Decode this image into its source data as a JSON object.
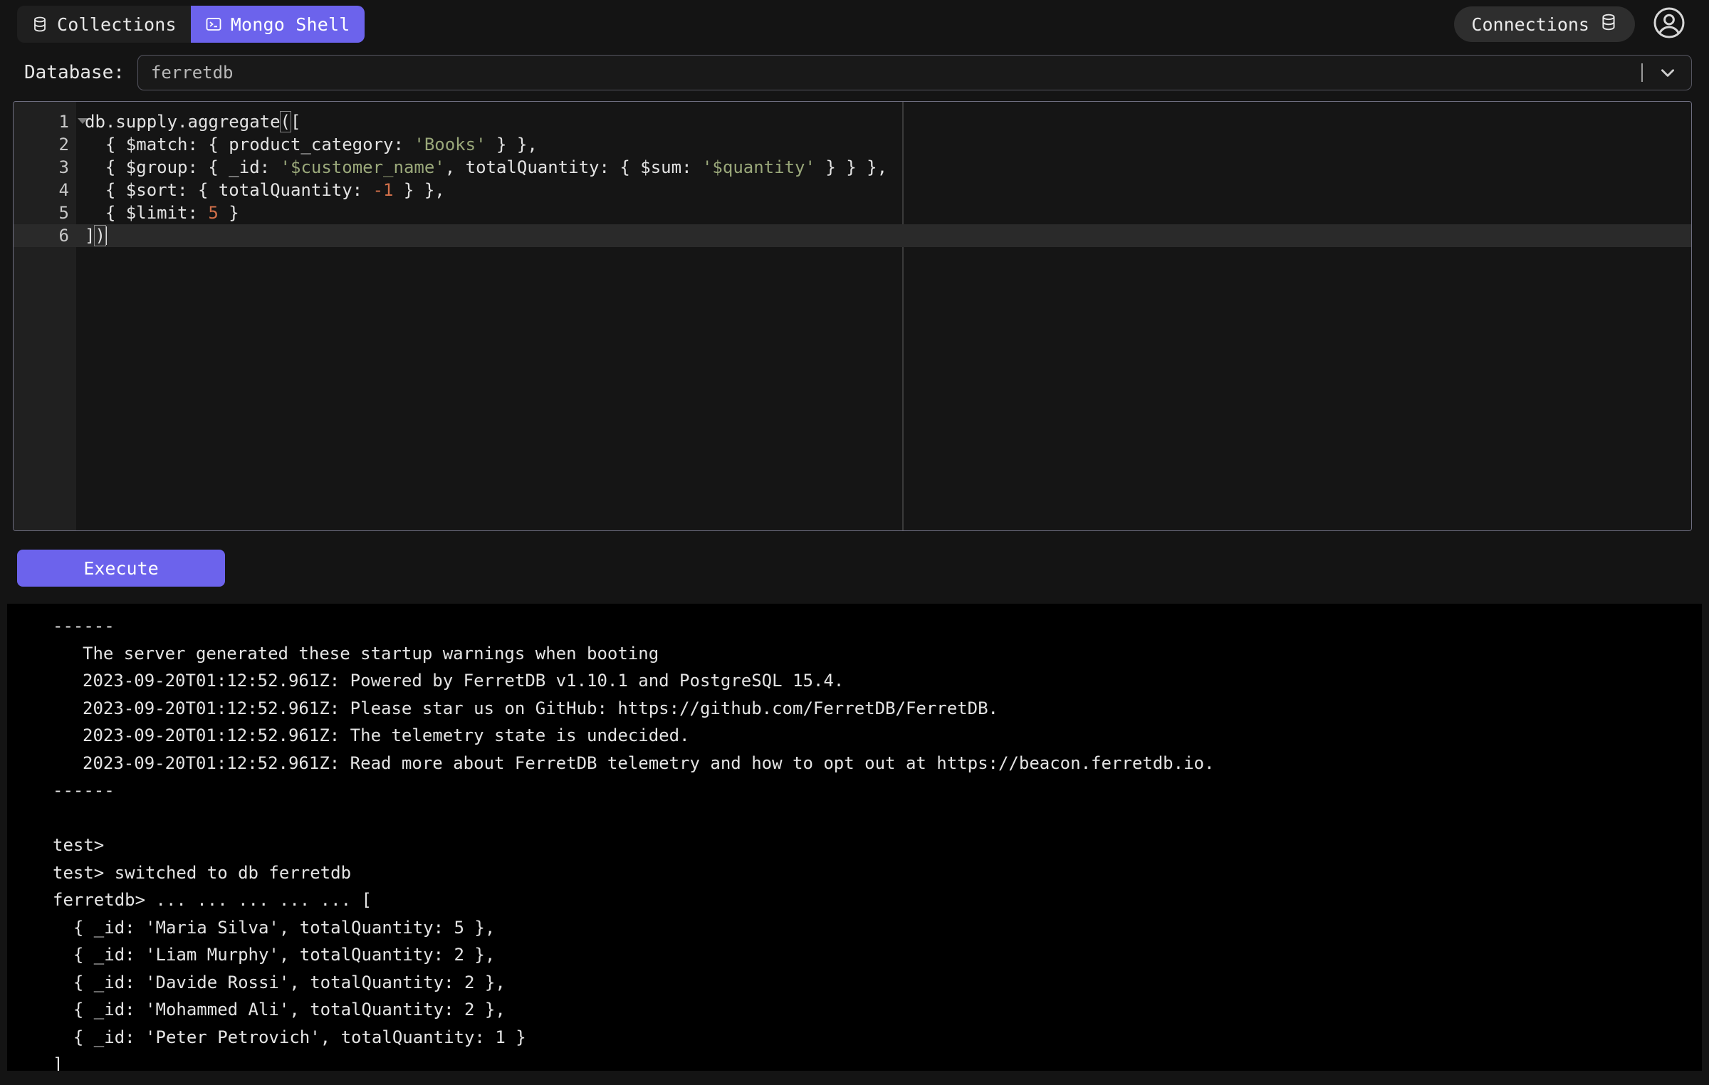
{
  "topbar": {
    "tabs": [
      {
        "label": "Collections",
        "icon": "database-icon",
        "active": false
      },
      {
        "label": "Mongo Shell",
        "icon": "terminal-icon",
        "active": true
      }
    ],
    "connections_label": "Connections",
    "connections_icon": "database-icon",
    "avatar_icon": "user-circle-icon"
  },
  "database": {
    "label": "Database:",
    "value": "ferretdb",
    "placeholder": "ferretdb",
    "dropdown_icon": "chevron-down-icon"
  },
  "editor": {
    "line_numbers": [
      "1",
      "2",
      "3",
      "4",
      "5",
      "6"
    ],
    "active_line": 6,
    "lines": [
      "db.supply.aggregate([",
      "  { $match: { product_category: 'Books' } },",
      "  { $group: { _id: '$customer_name', totalQuantity: { $sum: '$quantity' } } },",
      "  { $sort: { totalQuantity: -1 } },",
      "  { $limit: 5 }",
      "])"
    ]
  },
  "toolbar": {
    "execute_label": "Execute"
  },
  "console": {
    "lines": [
      {
        "text": "------",
        "indent": false
      },
      {
        "text": "The server generated these startup warnings when booting",
        "indent": true
      },
      {
        "text": "2023-09-20T01:12:52.961Z: Powered by FerretDB v1.10.1 and PostgreSQL 15.4.",
        "indent": true
      },
      {
        "text": "2023-09-20T01:12:52.961Z: Please star us on GitHub: https://github.com/FerretDB/FerretDB.",
        "indent": true
      },
      {
        "text": "2023-09-20T01:12:52.961Z: The telemetry state is undecided.",
        "indent": true
      },
      {
        "text": "2023-09-20T01:12:52.961Z: Read more about FerretDB telemetry and how to opt out at https://beacon.ferretdb.io.",
        "indent": true
      },
      {
        "text": "------",
        "indent": false
      },
      {
        "text": " ",
        "indent": false
      },
      {
        "text": "test>",
        "indent": false
      },
      {
        "text": "test> switched to db ferretdb",
        "indent": false
      },
      {
        "text": "ferretdb> ... ... ... ... ... [",
        "indent": false
      },
      {
        "text": "  { _id: 'Maria Silva', totalQuantity: 5 },",
        "indent": false
      },
      {
        "text": "  { _id: 'Liam Murphy', totalQuantity: 2 },",
        "indent": false
      },
      {
        "text": "  { _id: 'Davide Rossi', totalQuantity: 2 },",
        "indent": false
      },
      {
        "text": "  { _id: 'Mohammed Ali', totalQuantity: 2 },",
        "indent": false
      },
      {
        "text": "  { _id: 'Peter Petrovich', totalQuantity: 1 }",
        "indent": false
      },
      {
        "text": "]",
        "indent": false
      }
    ]
  },
  "colors": {
    "accent": "#6c63ec",
    "page_bg": "#141414",
    "console_bg": "#000000",
    "string_token": "#9aa87a",
    "number_token": "#d2704a"
  }
}
